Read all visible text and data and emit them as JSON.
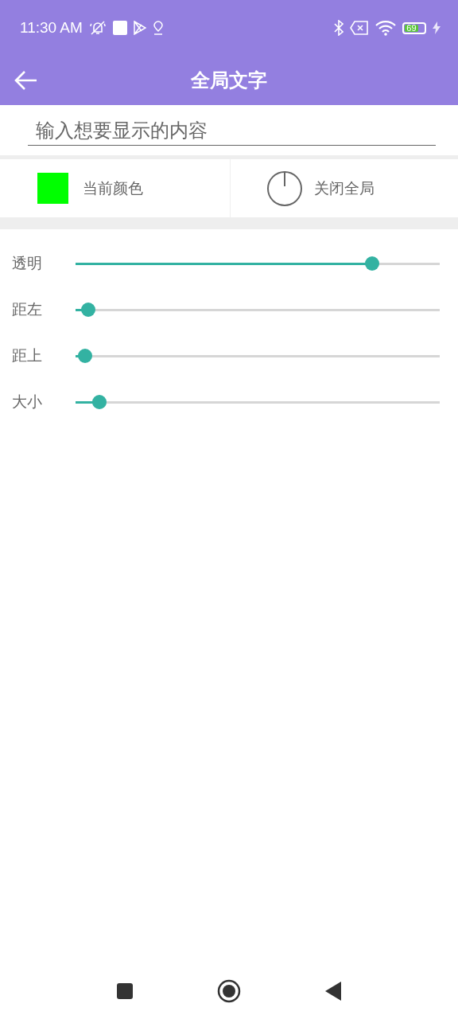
{
  "status_bar": {
    "time": "11:30 AM",
    "battery": "69"
  },
  "toolbar": {
    "title": "全局文字"
  },
  "text_input": {
    "placeholder": "输入想要显示的内容"
  },
  "actions": [
    {
      "kind": "color",
      "label": "当前颜色",
      "color": "#00ff00"
    },
    {
      "kind": "power",
      "label": "关闭全局"
    }
  ],
  "sliders": [
    {
      "label": "透明",
      "level": 0.8
    },
    {
      "label": "距左",
      "level": 0.02
    },
    {
      "label": "距上",
      "level": 0.01
    },
    {
      "label": "大小",
      "level": 0.05
    }
  ]
}
